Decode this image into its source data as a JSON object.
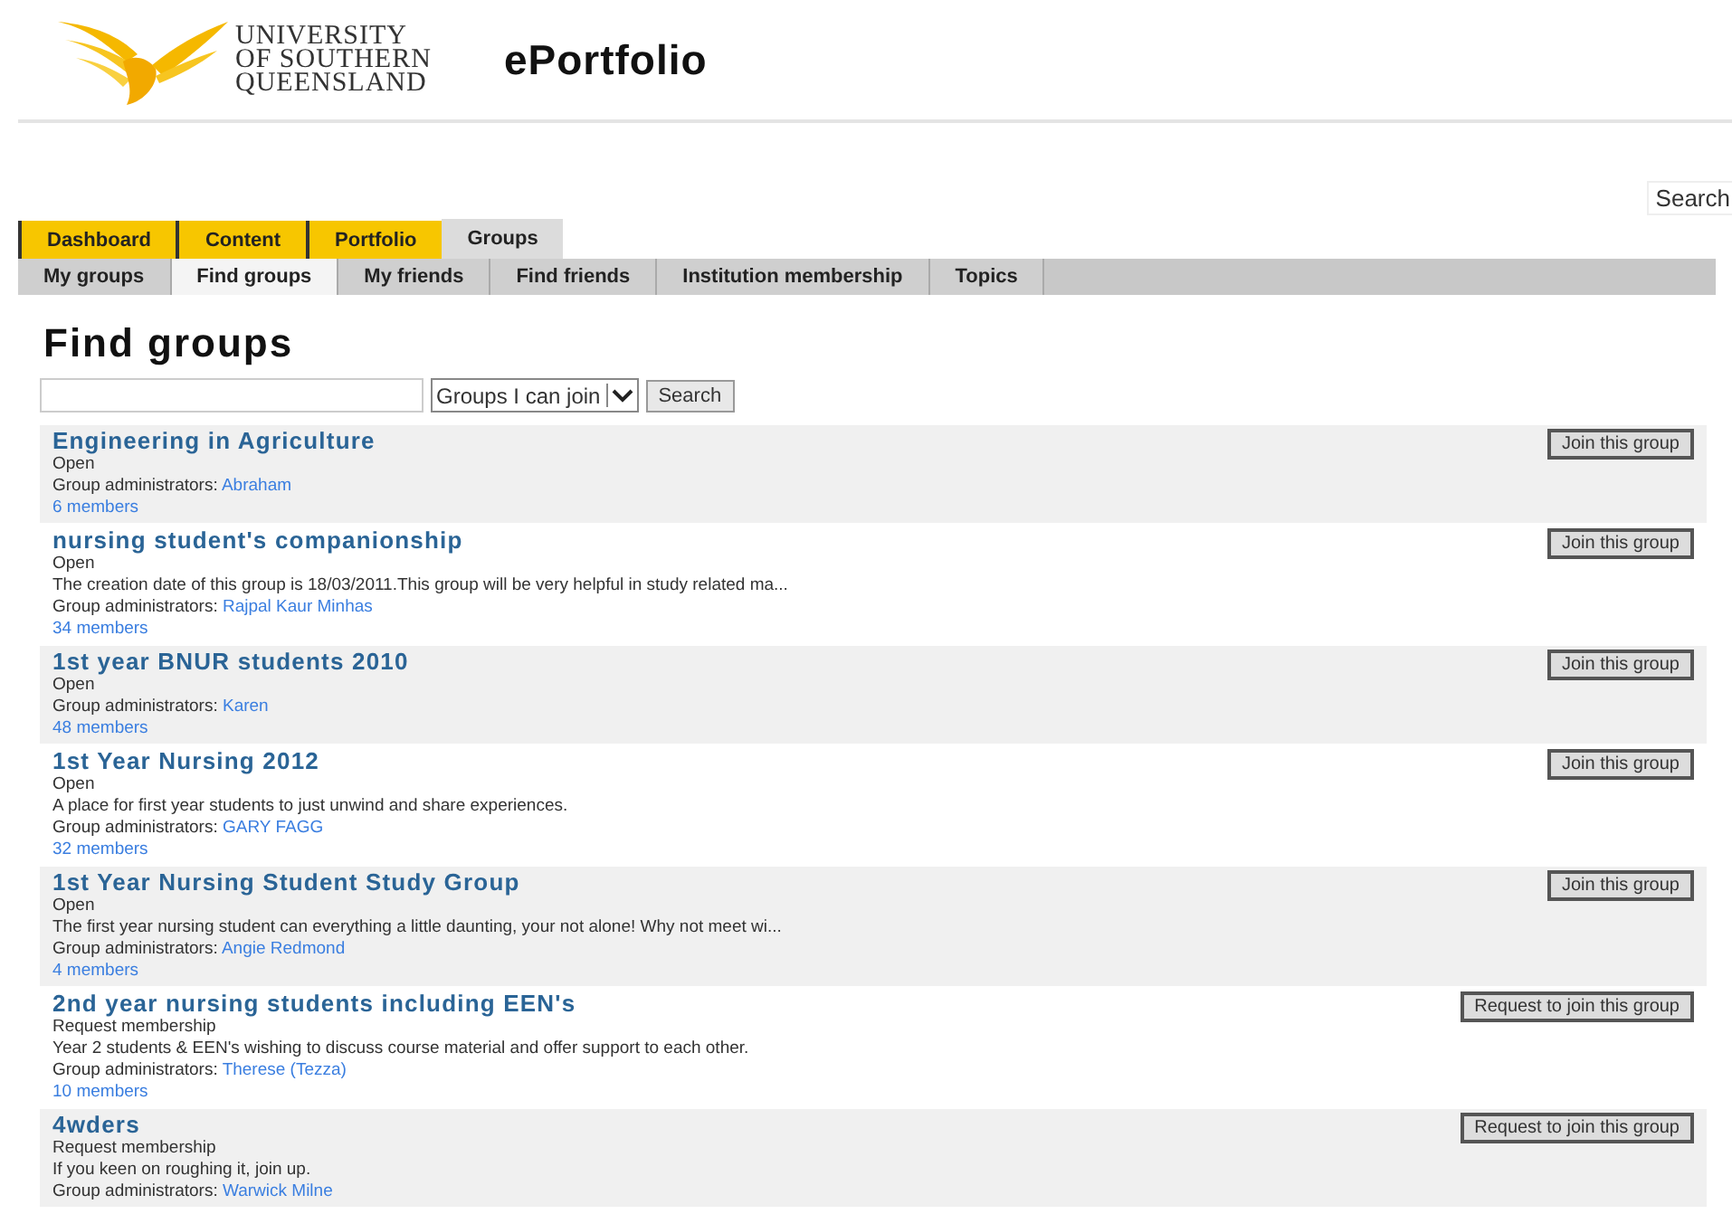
{
  "header": {
    "logo_lines": [
      "UNIVERSITY",
      "OF SOUTHERN",
      "QUEENSLAND"
    ],
    "title": "ePortfolio",
    "search_button": "Search"
  },
  "main_tabs": [
    {
      "label": "Dashboard",
      "selected": false
    },
    {
      "label": "Content",
      "selected": false
    },
    {
      "label": "Portfolio",
      "selected": false
    },
    {
      "label": "Groups",
      "selected": true
    }
  ],
  "sub_tabs": [
    {
      "label": "My groups",
      "selected": false
    },
    {
      "label": "Find groups",
      "selected": true
    },
    {
      "label": "My friends",
      "selected": false
    },
    {
      "label": "Find friends",
      "selected": false
    },
    {
      "label": "Institution membership",
      "selected": false
    },
    {
      "label": "Topics",
      "selected": false
    }
  ],
  "heading": "Find groups",
  "search": {
    "filter": "Groups I can join",
    "button": "Search"
  },
  "groups": [
    {
      "name": "Engineering in Agriculture",
      "membership": "Open",
      "admins_label": "Group administrators:",
      "admins": "Abraham",
      "members": "6 members",
      "button": "Join this group"
    },
    {
      "name": "nursing student's companionship",
      "membership": "Open",
      "description": "The creation date of this group is 18/03/2011.This group will be very helpful in study related ma...",
      "admins_label": "Group administrators:",
      "admins": "Rajpal Kaur Minhas",
      "members": "34 members",
      "button": "Join this group"
    },
    {
      "name": "1st year BNUR students 2010",
      "membership": "Open",
      "admins_label": "Group administrators:",
      "admins": "Karen",
      "members": "48 members",
      "button": "Join this group"
    },
    {
      "name": "1st Year Nursing 2012",
      "membership": "Open",
      "description": "A place for first year students to just unwind and share experiences.",
      "admins_label": "Group administrators:",
      "admins": "GARY FAGG",
      "members": "32 members",
      "button": "Join this group"
    },
    {
      "name": "1st Year Nursing Student Study Group",
      "membership": "Open",
      "description": "The first year nursing student can everything a little daunting, your not alone!  Why not meet wi...",
      "admins_label": "Group administrators:",
      "admins": "Angie Redmond",
      "members": "4 members",
      "button": "Join this group"
    },
    {
      "name": "2nd year nursing students including EEN's",
      "membership": "Request membership",
      "description": "Year 2 students & EEN's wishing to discuss course material and offer support to each other.",
      "admins_label": "Group administrators:",
      "admins": "Therese (Tezza)",
      "members": "10 members",
      "button": "Request to join this group"
    },
    {
      "name": "4wders",
      "membership": "Request membership",
      "description": "If you keen on roughing it, join up.",
      "admins_label": "Group administrators:",
      "admins": "Warwick Milne",
      "button": "Request to join this group"
    }
  ]
}
